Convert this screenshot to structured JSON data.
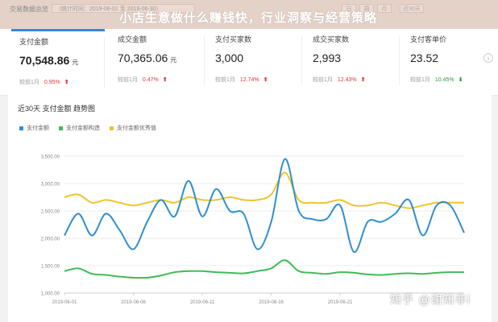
{
  "header": {
    "crumb": "交易数据总览",
    "date_range": "（统计时间：2019-06-01 至 2019-06-30）",
    "tabs": [
      "日",
      "周",
      "月",
      "近30天"
    ]
  },
  "overlay_title": "小店生意做什么赚钱快，行业洞察与经营策略",
  "metrics": [
    {
      "label": "支付金额",
      "value": "70,548.86",
      "unit": "元",
      "compare_label": "较前1月",
      "pct": "0.95%",
      "trend": "up",
      "arrow": "⬆",
      "selected": true
    },
    {
      "label": "成交金额",
      "value": "70,365.06",
      "unit": "元",
      "compare_label": "较前1月",
      "pct": "0.47%",
      "trend": "up",
      "arrow": "⬆",
      "selected": false
    },
    {
      "label": "支付买家数",
      "value": "3,000",
      "unit": "",
      "compare_label": "较前1月",
      "pct": "12.74%",
      "trend": "up",
      "arrow": "⬆",
      "selected": false
    },
    {
      "label": "成交买家数",
      "value": "2,993",
      "unit": "",
      "compare_label": "较前1月",
      "pct": "12.43%",
      "trend": "up",
      "arrow": "⬆",
      "selected": false
    },
    {
      "label": "支付客单价",
      "value": "23.52",
      "unit": "",
      "compare_label": "较前1月",
      "pct": "10.45%",
      "trend": "down",
      "arrow": "⬇",
      "selected": false
    }
  ],
  "nav_next_icon": "chevron-right-icon",
  "nav_next_glyph": "›",
  "chart": {
    "title": "近30天 支付金额 趋势图"
  },
  "chart_data": {
    "type": "line",
    "x": [
      "2019-06-01",
      "2019-06-02",
      "2019-06-03",
      "2019-06-04",
      "2019-06-05",
      "2019-06-06",
      "2019-06-07",
      "2019-06-08",
      "2019-06-09",
      "2019-06-10",
      "2019-06-11",
      "2019-06-12",
      "2019-06-13",
      "2019-06-14",
      "2019-06-15",
      "2019-06-16",
      "2019-06-17",
      "2019-06-18",
      "2019-06-19",
      "2019-06-20",
      "2019-06-21",
      "2019-06-22",
      "2019-06-23",
      "2019-06-24",
      "2019-06-25",
      "2019-06-26",
      "2019-06-27",
      "2019-06-28",
      "2019-06-29",
      "2019-06-30"
    ],
    "x_tick_labels": [
      "2019-06-01",
      "2019-06-06",
      "2019-06-11",
      "2019-06-16",
      "2019-06-21"
    ],
    "x_tick_indices": [
      0,
      5,
      10,
      15,
      20
    ],
    "ylim": [
      1000,
      3500
    ],
    "y_ticks": [
      "1,000.00",
      "1,500.00",
      "2,000.00",
      "2,500.00",
      "3,000.00",
      "3,500.00"
    ],
    "y_tick_values": [
      1000,
      1500,
      2000,
      2500,
      3000,
      3500
    ],
    "grid": true,
    "legend_position": "top-left",
    "series": [
      {
        "name": "支付金额",
        "color": "#2f8fd1",
        "values": [
          2050,
          2450,
          2050,
          2450,
          2150,
          1800,
          2300,
          2700,
          2400,
          3050,
          2400,
          2900,
          2500,
          2450,
          1800,
          2300,
          3450,
          2500,
          2350,
          2350,
          2600,
          1750,
          2300,
          2300,
          2450,
          2700,
          2050,
          2600,
          2600,
          2100
        ]
      },
      {
        "name": "支付金额构造",
        "color": "#3fbb57",
        "values": [
          1400,
          1450,
          1350,
          1330,
          1300,
          1280,
          1280,
          1320,
          1380,
          1400,
          1400,
          1380,
          1370,
          1360,
          1400,
          1450,
          1600,
          1400,
          1370,
          1350,
          1380,
          1370,
          1340,
          1330,
          1350,
          1360,
          1350,
          1370,
          1380,
          1380
        ]
      },
      {
        "name": "支付金额优秀值",
        "color": "#f0c42b",
        "values": [
          2750,
          2800,
          2650,
          2700,
          2650,
          2600,
          2650,
          2700,
          2650,
          2750,
          2700,
          2700,
          2750,
          2700,
          2700,
          2800,
          3200,
          2700,
          2650,
          2650,
          2700,
          2600,
          2600,
          2650,
          2600,
          2550,
          2600,
          2650,
          2650,
          2650
        ]
      }
    ]
  },
  "watermark": "知乎 @谢知非i"
}
